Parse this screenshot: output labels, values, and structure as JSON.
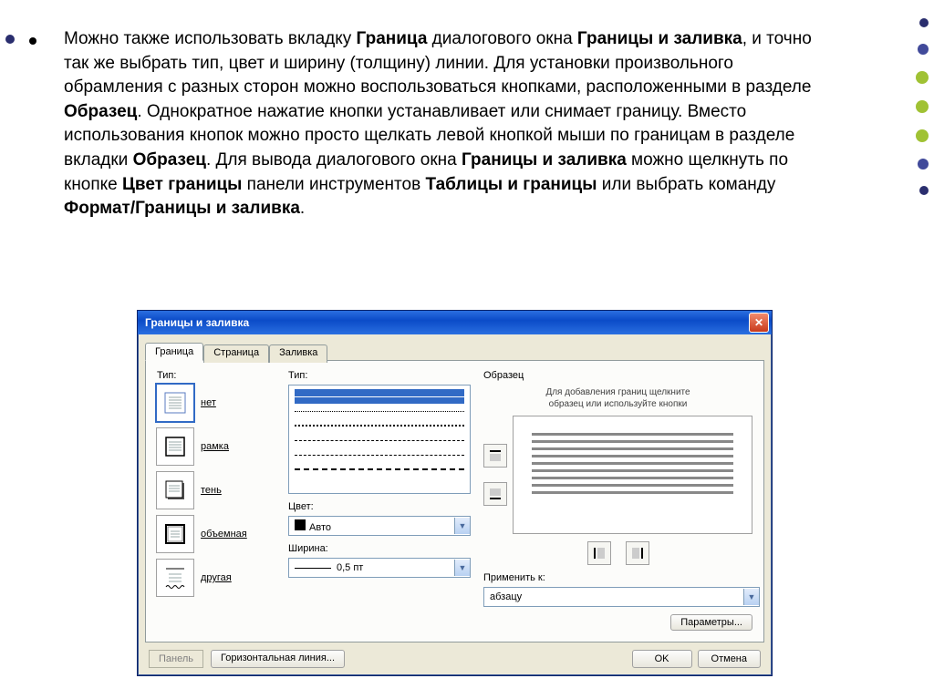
{
  "slide": {
    "paragraph_html": "Можно также использовать вкладку <b>Граница</b> диалогового окна <b>Границы и заливка</b>, и точно так же выбрать тип, цвет и ширину (толщину) линии. Для установки произвольного обрамления с разных сторон можно воспользоваться кнопками, расположенными в разделе <b>Образец</b>. Однократное нажатие кнопки устанавливает или снимает границу. Вместо использования кнопок можно просто щелкать левой кнопкой мыши по границам в разделе вкладки <b>Образец</b>. Для вывода диалогового окна <b>Границы и заливка</b> можно щелкнуть по кнопке <b>Цвет границы</b> панели инструментов <b>Таблицы и границы</b> или выбрать команду <b>Формат/Границы и заливка</b>."
  },
  "dialog": {
    "title": "Границы и заливка",
    "tabs": [
      "Граница",
      "Страница",
      "Заливка"
    ],
    "type_label": "Тип:",
    "types": [
      {
        "key": "none",
        "label": "нет"
      },
      {
        "key": "box",
        "label": "рамка"
      },
      {
        "key": "shadow",
        "label": "тень"
      },
      {
        "key": "3d",
        "label": "объемная"
      },
      {
        "key": "custom",
        "label": "другая"
      }
    ],
    "style_label": "Тип:",
    "color_label": "Цвет:",
    "color_value": "Авто",
    "width_label": "Ширина:",
    "width_value": "0,5 пт",
    "sample_label": "Образец",
    "sample_hint1": "Для добавления границ щелкните",
    "sample_hint2": "образец или используйте кнопки",
    "apply_label": "Применить к:",
    "apply_value": "абзацу",
    "params_button": "Параметры...",
    "panel_button": "Панель",
    "hline_button": "Горизонтальная линия...",
    "ok_button": "OK",
    "cancel_button": "Отмена"
  }
}
